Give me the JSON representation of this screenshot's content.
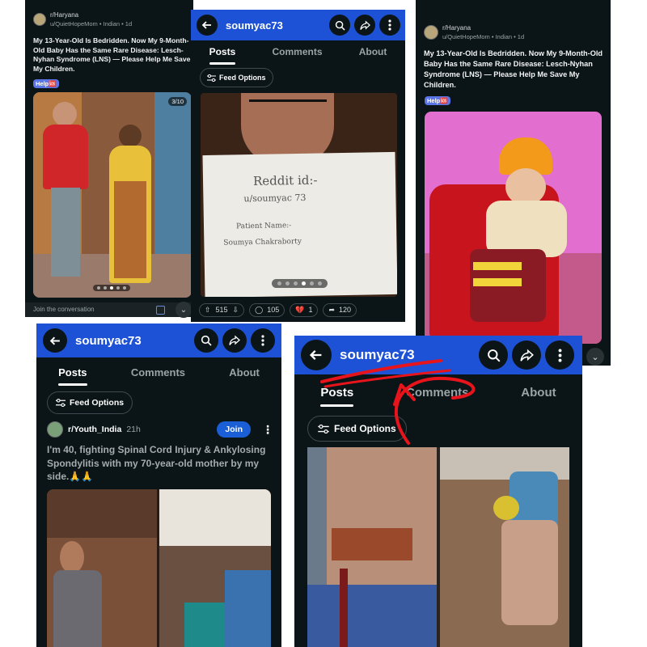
{
  "post_panel_left": {
    "subreddit": "r/Haryana",
    "user_meta": "u/QuietHopeMom • Indian • 1d",
    "title": "My 13-Year-Old Is Bedridden. Now My 9-Month-Old Baby Has the Same Rare Disease: Lesch-Nyhan Syndrome (LNS) — Please Help Me Save My Children.",
    "flair": "Help🆘",
    "image_counter": "3/10",
    "comment_placeholder": "Join the conversation"
  },
  "profile_panel_center": {
    "username": "soumyac73",
    "tabs": [
      "Posts",
      "Comments",
      "About"
    ],
    "feed_options": "Feed Options",
    "note_text": [
      "Reddit id:-",
      "u/soumyac 73",
      "Patient Name:-",
      "Soumya Chakraborty"
    ],
    "upvotes": "515",
    "comments": "105",
    "awards": "1",
    "shares": "120"
  },
  "post_panel_right": {
    "subreddit": "r/Haryana",
    "user_meta": "u/QuietHopeMom • Indian • 1d",
    "title": "My 13-Year-Old Is Bedridden. Now My 9-Month-Old Baby Has the Same Rare Disease: Lesch-Nyhan Syndrome (LNS) — Please Help Me Save My Children.",
    "flair": "Help🆘"
  },
  "profile_panel_bottom_left": {
    "username": "soumyac73",
    "tabs": [
      "Posts",
      "Comments",
      "About"
    ],
    "feed_options": "Feed Options",
    "subreddit": "r/Youth_India",
    "age": "21h",
    "join_label": "Join",
    "title": "I'm 40, fighting Spinal Cord Injury & Ankylosing Spondylitis with my 70-year-old mother by my side.🙏🙏"
  },
  "profile_panel_bottom_right": {
    "username": "soumyac73",
    "tabs": [
      "Posts",
      "Comments",
      "About"
    ],
    "feed_options": "Feed Options"
  },
  "colors": {
    "header_blue": "#1d52d6",
    "background": "#0b1416",
    "annotation_red": "#e8141c",
    "flair": "#5a75e8",
    "join_button": "#1a5fd6"
  }
}
